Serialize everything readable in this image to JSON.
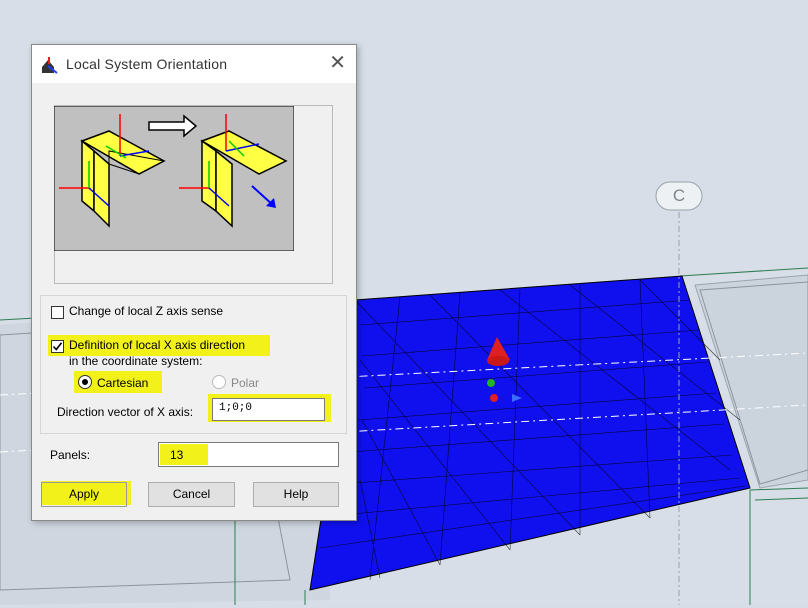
{
  "dialog": {
    "title": "Local System Orientation",
    "change_z_label": "Change of local Z axis sense",
    "change_z_checked": false,
    "define_x_label": "Definition of local X axis direction",
    "define_x_checked": true,
    "coord_system_label": "in the coordinate system:",
    "cartesian_label": "Cartesian",
    "cartesian_selected": true,
    "polar_label": "Polar",
    "polar_selected": false,
    "direction_label": "Direction vector of X axis:",
    "direction_value": "1;0;0",
    "panels_label": "Panels:",
    "panels_value": "13",
    "apply_label": "Apply",
    "cancel_label": "Cancel",
    "help_label": "Help"
  },
  "viewport": {
    "grid_marker_label": "C",
    "panel_color": "#1010ee",
    "background_color": "#d6dde6"
  },
  "colors": {
    "highlight": "#f2f21a",
    "axis_x": "#ff0000",
    "axis_y": "#22cc22",
    "axis_z": "#0000ff"
  }
}
